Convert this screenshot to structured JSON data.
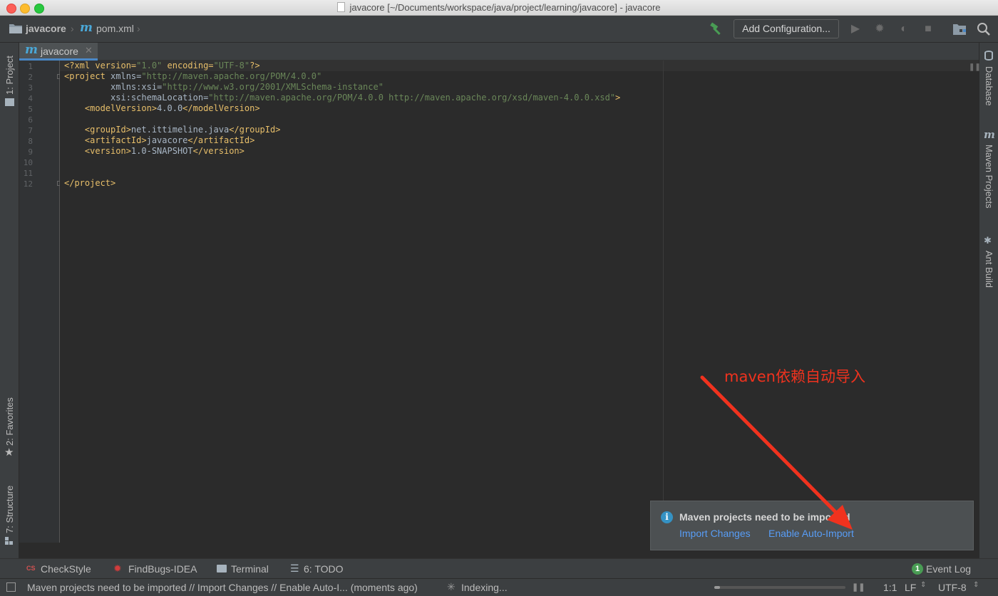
{
  "window": {
    "title": "javacore [~/Documents/workspace/java/project/learning/javacore] - javacore"
  },
  "breadcrumb": {
    "project": "javacore",
    "file": "pom.xml"
  },
  "toolbar": {
    "add_configuration": "Add Configuration..."
  },
  "left_tool_windows": {
    "project": "1: Project",
    "favorites": "2: Favorites",
    "structure": "7: Structure"
  },
  "right_tool_windows": {
    "database": "Database",
    "maven": "Maven Projects",
    "ant": "Ant Build"
  },
  "editor": {
    "tab_label": "javacore",
    "line_numbers": [
      "1",
      "2",
      "3",
      "4",
      "5",
      "6",
      "7",
      "8",
      "9",
      "10",
      "11",
      "12"
    ],
    "code": {
      "l1_a": "<?xml version=",
      "l1_b": "\"1.0\"",
      "l1_c": " encoding=",
      "l1_d": "\"UTF-8\"",
      "l1_e": "?>",
      "l2_a": "<project",
      "l2_b": " xmlns=",
      "l2_c": "\"http://maven.apache.org/POM/4.0.0\"",
      "l3_a": "         xmlns:xsi=",
      "l3_b": "\"http://www.w3.org/2001/XMLSchema-instance\"",
      "l4_a": "         xsi:schemaLocation=",
      "l4_b": "\"http://maven.apache.org/POM/4.0.0 http://maven.apache.org/xsd/maven-4.0.0.xsd\"",
      "l4_c": ">",
      "l5_a": "    <modelVersion>",
      "l5_b": "4.0.0",
      "l5_c": "</modelVersion>",
      "l7_a": "    <groupId>",
      "l7_b": "net.ittimeline.java",
      "l7_c": "</groupId>",
      "l8_a": "    <artifactId>",
      "l8_b": "javacore",
      "l8_c": "</artifactId>",
      "l9_a": "    <version>",
      "l9_b": "1.0-SNAPSHOT",
      "l9_c": "</version>",
      "l12_a": "</project>"
    }
  },
  "notification": {
    "title": "Maven projects need to be imported",
    "import_changes": "Import Changes",
    "enable_auto_import": "Enable Auto-Import"
  },
  "annotation": {
    "text": "maven依赖自动导入",
    "color": "#f0321e"
  },
  "bottom_tools": {
    "checkstyle": "CheckStyle",
    "findbugs": "FindBugs-IDEA",
    "terminal": "Terminal",
    "todo": "6: TODO",
    "event_log_count": "1",
    "event_log": "Event Log"
  },
  "status": {
    "message": "Maven projects need to be imported // Import Changes // Enable Auto-I... (moments ago)",
    "indexing": "Indexing...",
    "position": "1:1",
    "line_separator": "LF",
    "encoding": "UTF-8"
  }
}
